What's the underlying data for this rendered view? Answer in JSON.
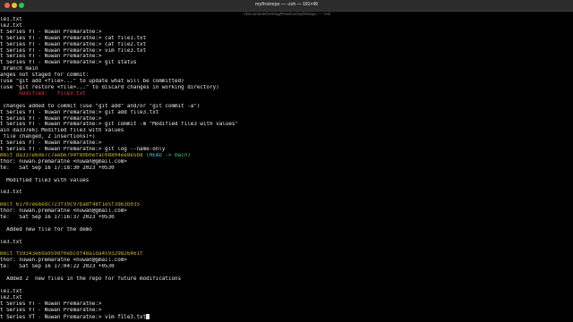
{
  "window": {
    "title": "myfirstrepo — -zsh — 191×49",
    "subtitle": "~/Documents/Verting/Practice/myfirstrepo — -zsh"
  },
  "colors": {
    "default": "#e8e8e8",
    "red": "#e0393e",
    "yellow": "#c8b12c",
    "cyan": "#3fc2d6",
    "green": "#2fd25a"
  },
  "terminal": {
    "lines": [
      [
        {
          "t": "le1.txt",
          "c": "default"
        }
      ],
      [
        {
          "t": "le2.txt",
          "c": "default"
        }
      ],
      [
        {
          "t": "t Series YT - Nuwan Premaratne:>",
          "c": "default"
        }
      ],
      [
        {
          "t": "t Series YT - Nuwan Premaratne:> cat file1.txt",
          "c": "default"
        }
      ],
      [
        {
          "t": "t Series YT - Nuwan Premaratne:> cat file2.txt",
          "c": "default"
        }
      ],
      [
        {
          "t": "t Series YT - Nuwan Premaratne:> vim file3.txt",
          "c": "default"
        }
      ],
      [
        {
          "t": "t Series YT - Nuwan Premaratne:>",
          "c": "default"
        }
      ],
      [
        {
          "t": "t Series YT - Nuwan Premaratne:> git status",
          "c": "default"
        }
      ],
      [
        {
          "t": " branch main",
          "c": "default"
        }
      ],
      [
        {
          "t": "anges not staged for commit:",
          "c": "default"
        }
      ],
      [
        {
          "t": "(use \"git add <file>...\" to update what will be committed)",
          "c": "default"
        }
      ],
      [
        {
          "t": "(use \"git restore <file>...\" to discard changes in working directory)",
          "c": "default"
        }
      ],
      [
        {
          "t": "      modified:   file3.txt",
          "c": "red"
        }
      ],
      [
        {
          "t": "",
          "c": "default"
        }
      ],
      [
        {
          "t": " changes added to commit (use \"git add\" and/or \"git commit -a\")",
          "c": "default"
        }
      ],
      [
        {
          "t": "t Series YT - Nuwan Premaratne:> git add file3.txt",
          "c": "default"
        }
      ],
      [
        {
          "t": "t Series YT - Nuwan Premaratne:>",
          "c": "default"
        }
      ],
      [
        {
          "t": "t Series YT - Nuwan Premaratne:> git commit -m \"Modified file3 with values\"",
          "c": "default"
        }
      ],
      [
        {
          "t": "ain da337e6] Modified file3 with values",
          "c": "default"
        }
      ],
      [
        {
          "t": " file changed, 2 insertions(+)",
          "c": "default"
        }
      ],
      [
        {
          "t": "t Series YT - Nuwan Premaratne:>",
          "c": "default"
        }
      ],
      [
        {
          "t": "t Series YT - Nuwan Premaratne:> git log --name-only",
          "c": "default"
        }
      ],
      [
        {
          "t": "mmit da337e6de7c7aeb6794f80b0efac08804ee8e5b8 ",
          "c": "yellow"
        },
        {
          "t": "(",
          "c": "yellow"
        },
        {
          "t": "HEAD -> ",
          "c": "cyan"
        },
        {
          "t": "main",
          "c": "green"
        },
        {
          "t": ")",
          "c": "yellow"
        }
      ],
      [
        {
          "t": "thor: nuwan.premaratne <nuwan@gmail.com>",
          "c": "default"
        }
      ],
      [
        {
          "t": "te:   Sat Sep 16 17:18:30 2023 +0530",
          "c": "default"
        }
      ],
      [
        {
          "t": "",
          "c": "default"
        }
      ],
      [
        {
          "t": "  Modified file3 with values",
          "c": "default"
        }
      ],
      [
        {
          "t": "",
          "c": "default"
        }
      ],
      [
        {
          "t": "le3.txt",
          "c": "default"
        }
      ],
      [
        {
          "t": "",
          "c": "default"
        }
      ],
      [
        {
          "t": "mmit 61707ee8edc723f39c97ba8f48f1e5f3d63b035",
          "c": "yellow"
        }
      ],
      [
        {
          "t": "thor: nuwan.premaratne <nuwan@gmail.com>",
          "c": "default"
        }
      ],
      [
        {
          "t": "te:   Sat Sep 16 17:16:37 2023 +0530",
          "c": "default"
        }
      ],
      [
        {
          "t": "",
          "c": "default"
        }
      ],
      [
        {
          "t": "  Added new file for the demo",
          "c": "default"
        }
      ],
      [
        {
          "t": "",
          "c": "default"
        }
      ],
      [
        {
          "t": "le3.txt",
          "c": "default"
        }
      ],
      [
        {
          "t": "",
          "c": "default"
        }
      ],
      [
        {
          "t": "mmit f59343e69a9598f0ebcdf48a1da459329826461f",
          "c": "yellow"
        }
      ],
      [
        {
          "t": "thor: nuwan.premaratne <nuwan@gmail.com>",
          "c": "default"
        }
      ],
      [
        {
          "t": "te:   Sat Sep 16 17:04:22 2023 +0530",
          "c": "default"
        }
      ],
      [
        {
          "t": "",
          "c": "default"
        }
      ],
      [
        {
          "t": "  Added 2  new files in the repo for future modifications",
          "c": "default"
        }
      ],
      [
        {
          "t": "",
          "c": "default"
        }
      ],
      [
        {
          "t": "le1.txt",
          "c": "default"
        }
      ],
      [
        {
          "t": "le2.txt",
          "c": "default"
        }
      ],
      [
        {
          "t": "t Series YT - Nuwan Premaratne:>",
          "c": "default"
        }
      ],
      [
        {
          "t": "t Series YT - Nuwan Premaratne:>",
          "c": "default"
        }
      ],
      [
        {
          "t": "t Series YT - Nuwan Premaratne:> vim file3.txt",
          "c": "default"
        }
      ]
    ]
  }
}
